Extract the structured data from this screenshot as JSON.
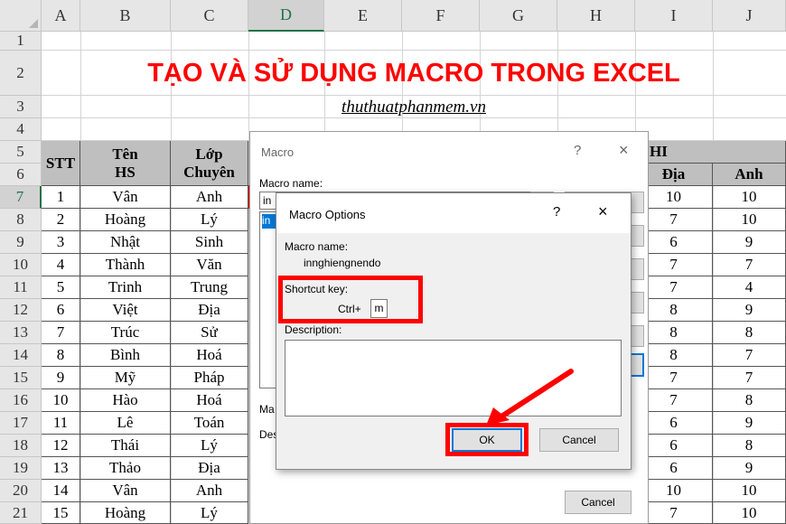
{
  "columns": [
    "A",
    "B",
    "C",
    "D",
    "E",
    "F",
    "G",
    "H",
    "I",
    "J"
  ],
  "rows": [
    "1",
    "2",
    "3",
    "4",
    "5",
    "6",
    "7",
    "8",
    "9",
    "10",
    "11",
    "12",
    "13",
    "14",
    "15",
    "16",
    "17",
    "18",
    "19",
    "20",
    "21"
  ],
  "title": "TẠO VÀ SỬ DỤNG MACRO TRONG EXCEL",
  "subtitle": "thuthuatphanmem.vn",
  "table": {
    "stt_header": "STT",
    "ten_header_1": "Tên",
    "ten_header_2": "HS",
    "lop_header_1": "Lớp",
    "lop_header_2": "Chuyên",
    "thi_header": "HI",
    "dia_header": "Địa",
    "anh_header": "Anh",
    "rows": [
      {
        "stt": "1",
        "ten": "Vân",
        "lop": "Anh",
        "dia": "10",
        "anh": "10"
      },
      {
        "stt": "2",
        "ten": "Hoàng",
        "lop": "Lý",
        "dia": "7",
        "anh": "10"
      },
      {
        "stt": "3",
        "ten": "Nhật",
        "lop": "Sinh",
        "dia": "6",
        "anh": "9"
      },
      {
        "stt": "4",
        "ten": "Thành",
        "lop": "Văn",
        "dia": "7",
        "anh": "7"
      },
      {
        "stt": "5",
        "ten": "Trinh",
        "lop": "Trung",
        "dia": "7",
        "anh": "4"
      },
      {
        "stt": "6",
        "ten": "Việt",
        "lop": "Địa",
        "dia": "8",
        "anh": "9"
      },
      {
        "stt": "7",
        "ten": "Trúc",
        "lop": "Sử",
        "dia": "8",
        "anh": "8"
      },
      {
        "stt": "8",
        "ten": "Bình",
        "lop": "Hoá",
        "dia": "8",
        "anh": "7"
      },
      {
        "stt": "9",
        "ten": "Mỹ",
        "lop": "Pháp",
        "dia": "7",
        "anh": "7"
      },
      {
        "stt": "10",
        "ten": "Hào",
        "lop": "Hoá",
        "dia": "7",
        "anh": "8"
      },
      {
        "stt": "11",
        "ten": "Lê",
        "lop": "Toán",
        "dia": "6",
        "anh": "9"
      },
      {
        "stt": "12",
        "ten": "Thái",
        "lop": "Lý",
        "dia": "6",
        "anh": "8"
      },
      {
        "stt": "13",
        "ten": "Thảo",
        "lop": "Địa",
        "dia": "6",
        "anh": "9"
      },
      {
        "stt": "14",
        "ten": "Vân",
        "lop": "Anh",
        "dia": "10",
        "anh": "10"
      },
      {
        "stt": "15",
        "ten": "Hoàng",
        "lop": "Lý",
        "dia": "7",
        "anh": "10"
      }
    ]
  },
  "macro_dialog": {
    "title": "Macro",
    "help": "?",
    "close": "×",
    "macro_name_label": "Macro name:",
    "macro_name_value": "in",
    "list_selected": "in",
    "ma_label": "Ma",
    "des_label": "Des",
    "cancel": "Cancel"
  },
  "options_dialog": {
    "title": "Macro Options",
    "help": "?",
    "close": "×",
    "macro_name_label": "Macro name:",
    "macro_name_value": "innghiengnendo",
    "shortcut_label": "Shortcut key:",
    "ctrl_label": "Ctrl+",
    "shortcut_value": "m",
    "description_label": "Description:",
    "ok": "OK",
    "cancel": "Cancel"
  },
  "colors": {
    "accent_red": "#ff0000",
    "excel_green": "#217346",
    "header_gray": "#bfbfbf"
  }
}
